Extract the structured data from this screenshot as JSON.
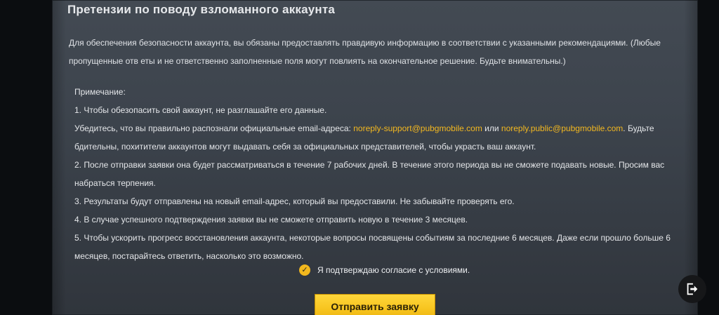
{
  "header": {
    "title": "Претензии по поводу взломанного аккаунта"
  },
  "intro": {
    "text": "Для обеспечения безопасности аккаунта, вы обязаны предоставлять правдивую информацию в соответствии с указанными рекомендациями. (Любые пропущенные отв еты и не ответственно заполненные поля могут повлиять на окончательное решение. Будьте внимательны.)"
  },
  "notes": {
    "heading": "Примечание:",
    "item1": "1. Чтобы обезопасить свой аккаунт, не разглашайте его данные.",
    "item1_sub_prefix": "Убедитесь, что вы правильно распознали официальные email-адреса: ",
    "email_1": "noreply-support@pubgmobile.com",
    "item1_sub_or": " или ",
    "email_2": "noreply.public@pubgmobile.com",
    "item1_sub_suffix": ". Будьте бдительны, похитители аккаунтов могут выдавать себя за официальных представителей, чтобы украсть ваш аккаунт.",
    "item2": "2. После отправки заявки она будет рассматриваться в течение 7 рабочих дней. В течение этого периода вы не сможете подавать новые. Просим вас набраться терпения.",
    "item3": "3. Результаты будут отправлены на новый email-адрес, который вы предоставили. Не забывайте проверять его.",
    "item4": "4. В случае успешного подтверждения заявки вы не сможете отправить новую в течение 3 месяцев.",
    "item5": "5. Чтобы ускорить прогресс восстановления аккаунта, некоторые вопросы посвящены событиям за последние 6 месяцев. Даже если прошло больше 6 месяцев, постарайтесь ответить, насколько это возможно."
  },
  "agreement": {
    "label": "Я подтверждаю согласие с условиями.",
    "checked": true,
    "check_glyph": "✓"
  },
  "actions": {
    "submit_label": "Отправить заявку"
  },
  "colors": {
    "accent": "#f3b820",
    "panel": "#3d444d"
  },
  "icons": {
    "exit": "exit-icon",
    "check": "checkmark-icon"
  }
}
